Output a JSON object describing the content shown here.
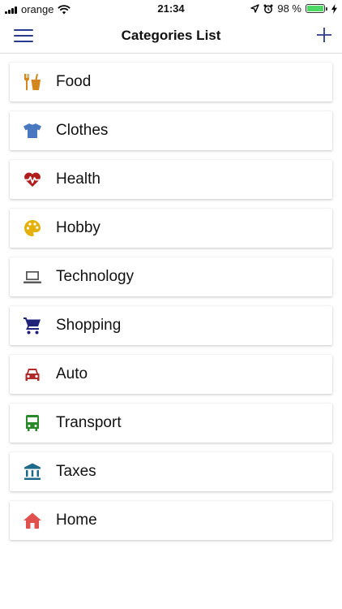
{
  "status_bar": {
    "carrier": "orange",
    "time": "21:34",
    "battery_percent": "98 %",
    "battery_level": 0.98
  },
  "header": {
    "title": "Categories List",
    "menu_icon": "hamburger-icon",
    "add_icon": "plus-icon",
    "accent_color": "#2b3a8c"
  },
  "categories": [
    {
      "label": "Food",
      "icon": "food-icon",
      "color": "#d4861c"
    },
    {
      "label": "Clothes",
      "icon": "shirt-icon",
      "color": "#4a78c0"
    },
    {
      "label": "Health",
      "icon": "heart-pulse-icon",
      "color": "#b01c1c"
    },
    {
      "label": "Hobby",
      "icon": "palette-icon",
      "color": "#e3b10a"
    },
    {
      "label": "Technology",
      "icon": "laptop-icon",
      "color": "#5a5a5a"
    },
    {
      "label": "Shopping",
      "icon": "cart-icon",
      "color": "#1f237a"
    },
    {
      "label": "Auto",
      "icon": "car-icon",
      "color": "#b02a2a"
    },
    {
      "label": "Transport",
      "icon": "bus-icon",
      "color": "#2a8a2a"
    },
    {
      "label": "Taxes",
      "icon": "bank-icon",
      "color": "#1e6a8a"
    },
    {
      "label": "Home",
      "icon": "home-icon",
      "color": "#e0504d"
    }
  ]
}
